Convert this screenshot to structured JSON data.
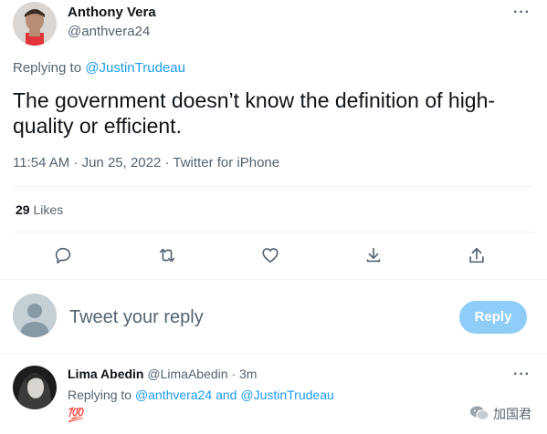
{
  "tweet": {
    "author_name": "Anthony Vera",
    "author_handle": "@anthvera24",
    "more_icon": "···",
    "replying_prefix": "Replying to",
    "replying_to": "@JustinTrudeau",
    "text": "The government doesn’t know the definition of high-quality or efficient.",
    "meta": "11:54 AM · Jun 25, 2022 · Twitter for iPhone",
    "likes_count": "29",
    "likes_label": "Likes"
  },
  "actions": [
    "comment-icon",
    "retweet-icon",
    "like-icon",
    "share-icon",
    "upload-icon"
  ],
  "compose": {
    "placeholder": "Tweet your reply",
    "button_label": "Reply"
  },
  "reply": {
    "author_name": "Lima Abedin",
    "author_handle": "@LimaAbedin",
    "sep": "·",
    "time": "3m",
    "more_icon": "···",
    "replying_prefix": "Replying to",
    "mention_1": "@anthvera24",
    "and_word": "and",
    "mention_2": "@JustinTrudeau",
    "emoji": "💯"
  },
  "watermark": {
    "text": "加国君"
  },
  "colors": {
    "link": "#1d9bf0",
    "muted": "#536471",
    "reply_button": "#8ecdf8",
    "divider": "#eff3f4"
  }
}
